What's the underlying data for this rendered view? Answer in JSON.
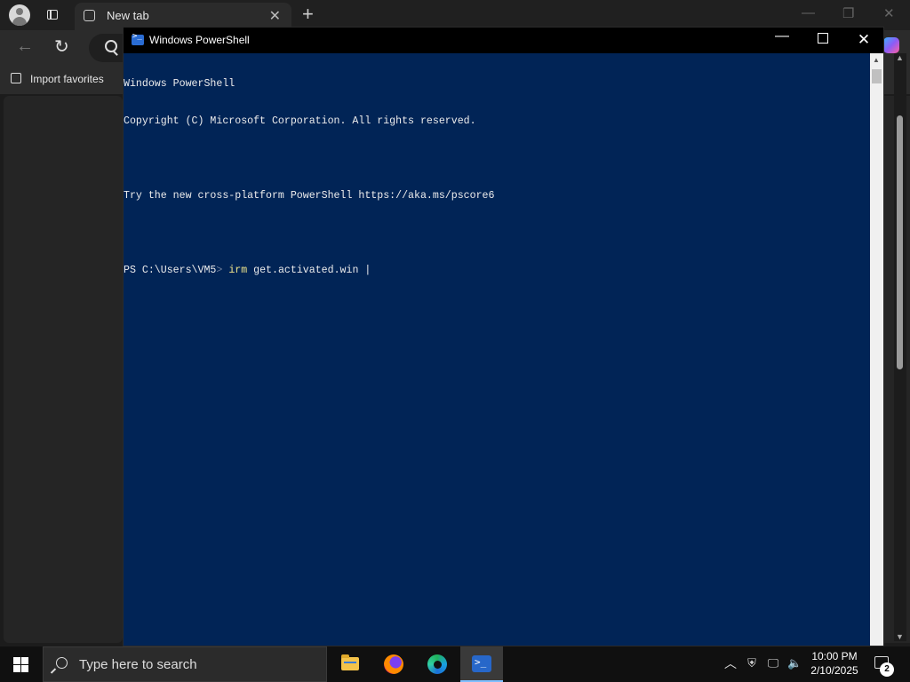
{
  "browser": {
    "tab_title": "New tab",
    "favorites_label": "Import favorites"
  },
  "powershell": {
    "title": "Windows PowerShell",
    "lines": [
      "Windows PowerShell",
      "Copyright (C) Microsoft Corporation. All rights reserved.",
      "",
      "Try the new cross-platform PowerShell https://aka.ms/pscore6",
      ""
    ],
    "prompt": "PS C:\\Users\\VM5",
    "prompt_symbol": ">",
    "command_keyword": "irm",
    "command_arg": " get.activated.win ",
    "cursor": "|",
    "background_color": "#012456"
  },
  "taskbar": {
    "search_placeholder": "Type here to search",
    "time": "10:00 PM",
    "date": "2/10/2025",
    "notification_count": "2",
    "apps": [
      "file-explorer",
      "firefox",
      "edge",
      "powershell"
    ],
    "active_app": "powershell"
  }
}
